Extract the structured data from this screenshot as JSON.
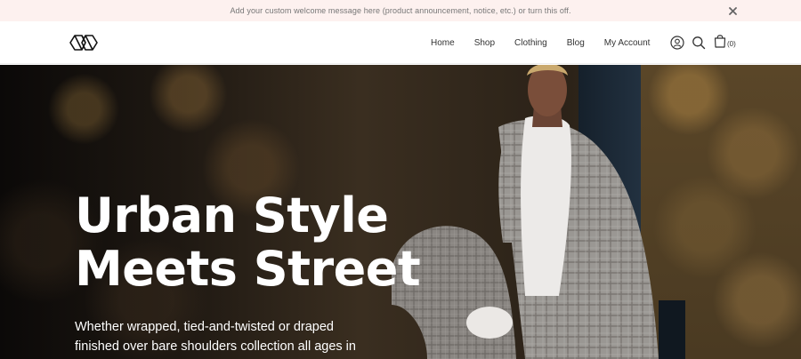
{
  "announcement": {
    "text": "Add your custom welcome message here (product announcement, notice, etc.) or turn this off.",
    "close_icon": "close-icon"
  },
  "header": {
    "logo_icon": "brand-logo",
    "nav": [
      {
        "label": "Home"
      },
      {
        "label": "Shop"
      },
      {
        "label": "Clothing"
      },
      {
        "label": "Blog"
      },
      {
        "label": "My Account"
      }
    ],
    "icons": [
      "account-icon",
      "search-icon",
      "shopping-bag-icon"
    ],
    "cart_count": "(0)"
  },
  "hero": {
    "title_line1": "Urban Style",
    "title_line2": "Meets Street",
    "subtitle": "Whether wrapped, tied-and-twisted or draped finished over bare shoulders collection all ages in time."
  },
  "colors": {
    "announcement_bg": "#fdf1ef",
    "text_dark": "#222222",
    "hero_text": "#ffffff"
  }
}
